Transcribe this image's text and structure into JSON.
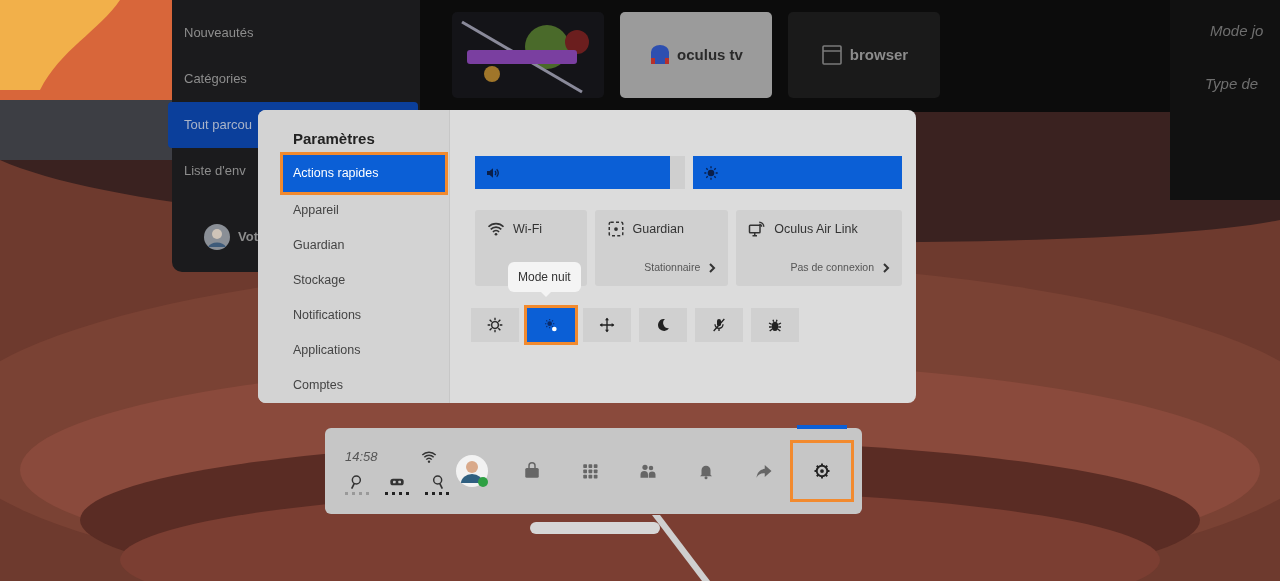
{
  "store": {
    "menu": [
      {
        "label": "Nouveautés",
        "selected": false
      },
      {
        "label": "Catégories",
        "selected": false
      },
      {
        "label": "Tout parcou",
        "selected": true
      },
      {
        "label": "Liste d'env",
        "selected": false
      }
    ],
    "profile": {
      "label": "Vot"
    },
    "tiles": [
      {
        "kind": "picture"
      },
      {
        "kind": "tv",
        "label": "oculus tv",
        "selected": true
      },
      {
        "kind": "browser",
        "label": "browser",
        "selected": false
      }
    ]
  },
  "side_panel": {
    "items": [
      "Mode jo",
      "Type de"
    ]
  },
  "settings": {
    "title": "Paramètres",
    "nav": [
      {
        "label": "Actions rapides",
        "selected": true,
        "highlighted": true
      },
      {
        "label": "Appareil",
        "selected": false,
        "highlighted": false
      },
      {
        "label": "Guardian",
        "selected": false,
        "highlighted": false
      },
      {
        "label": "Stockage",
        "selected": false,
        "highlighted": false
      },
      {
        "label": "Notifications",
        "selected": false,
        "highlighted": false
      },
      {
        "label": "Applications",
        "selected": false,
        "highlighted": false
      },
      {
        "label": "Comptes",
        "selected": false,
        "highlighted": false
      }
    ],
    "sliders": [
      {
        "kind": "volume",
        "level": 0.93
      },
      {
        "kind": "brightness",
        "level": 1
      }
    ],
    "tiles": [
      {
        "kind": "wifi",
        "title": "Wi-Fi"
      },
      {
        "kind": "guardian",
        "title": "Guardian",
        "status": "Stationnaire"
      },
      {
        "kind": "link",
        "title": "Oculus Air Link",
        "status": "Pas de connexion"
      }
    ],
    "toggles": [
      {
        "kind": "brightness",
        "selected": false,
        "highlighted": false
      },
      {
        "kind": "night",
        "selected": true,
        "highlighted": true
      },
      {
        "kind": "move",
        "selected": false,
        "highlighted": false
      },
      {
        "kind": "moon",
        "selected": false,
        "highlighted": false
      },
      {
        "kind": "mic",
        "selected": false,
        "highlighted": false
      },
      {
        "kind": "bug",
        "selected": false,
        "highlighted": false
      }
    ],
    "tooltip": "Mode nuit"
  },
  "taskbar": {
    "time": "14:58",
    "controllers": [
      {
        "kind": "left",
        "active": false
      },
      {
        "kind": "headset",
        "active": true
      },
      {
        "kind": "right",
        "active": true
      }
    ],
    "apps": [
      {
        "kind": "store",
        "selected": false,
        "highlighted": false
      },
      {
        "kind": "grid",
        "selected": false,
        "highlighted": false
      },
      {
        "kind": "people",
        "selected": false,
        "highlighted": false
      },
      {
        "kind": "bell",
        "selected": false,
        "highlighted": false
      },
      {
        "kind": "share",
        "selected": false,
        "highlighted": false
      },
      {
        "kind": "settings",
        "selected": true,
        "highlighted": true
      }
    ]
  }
}
